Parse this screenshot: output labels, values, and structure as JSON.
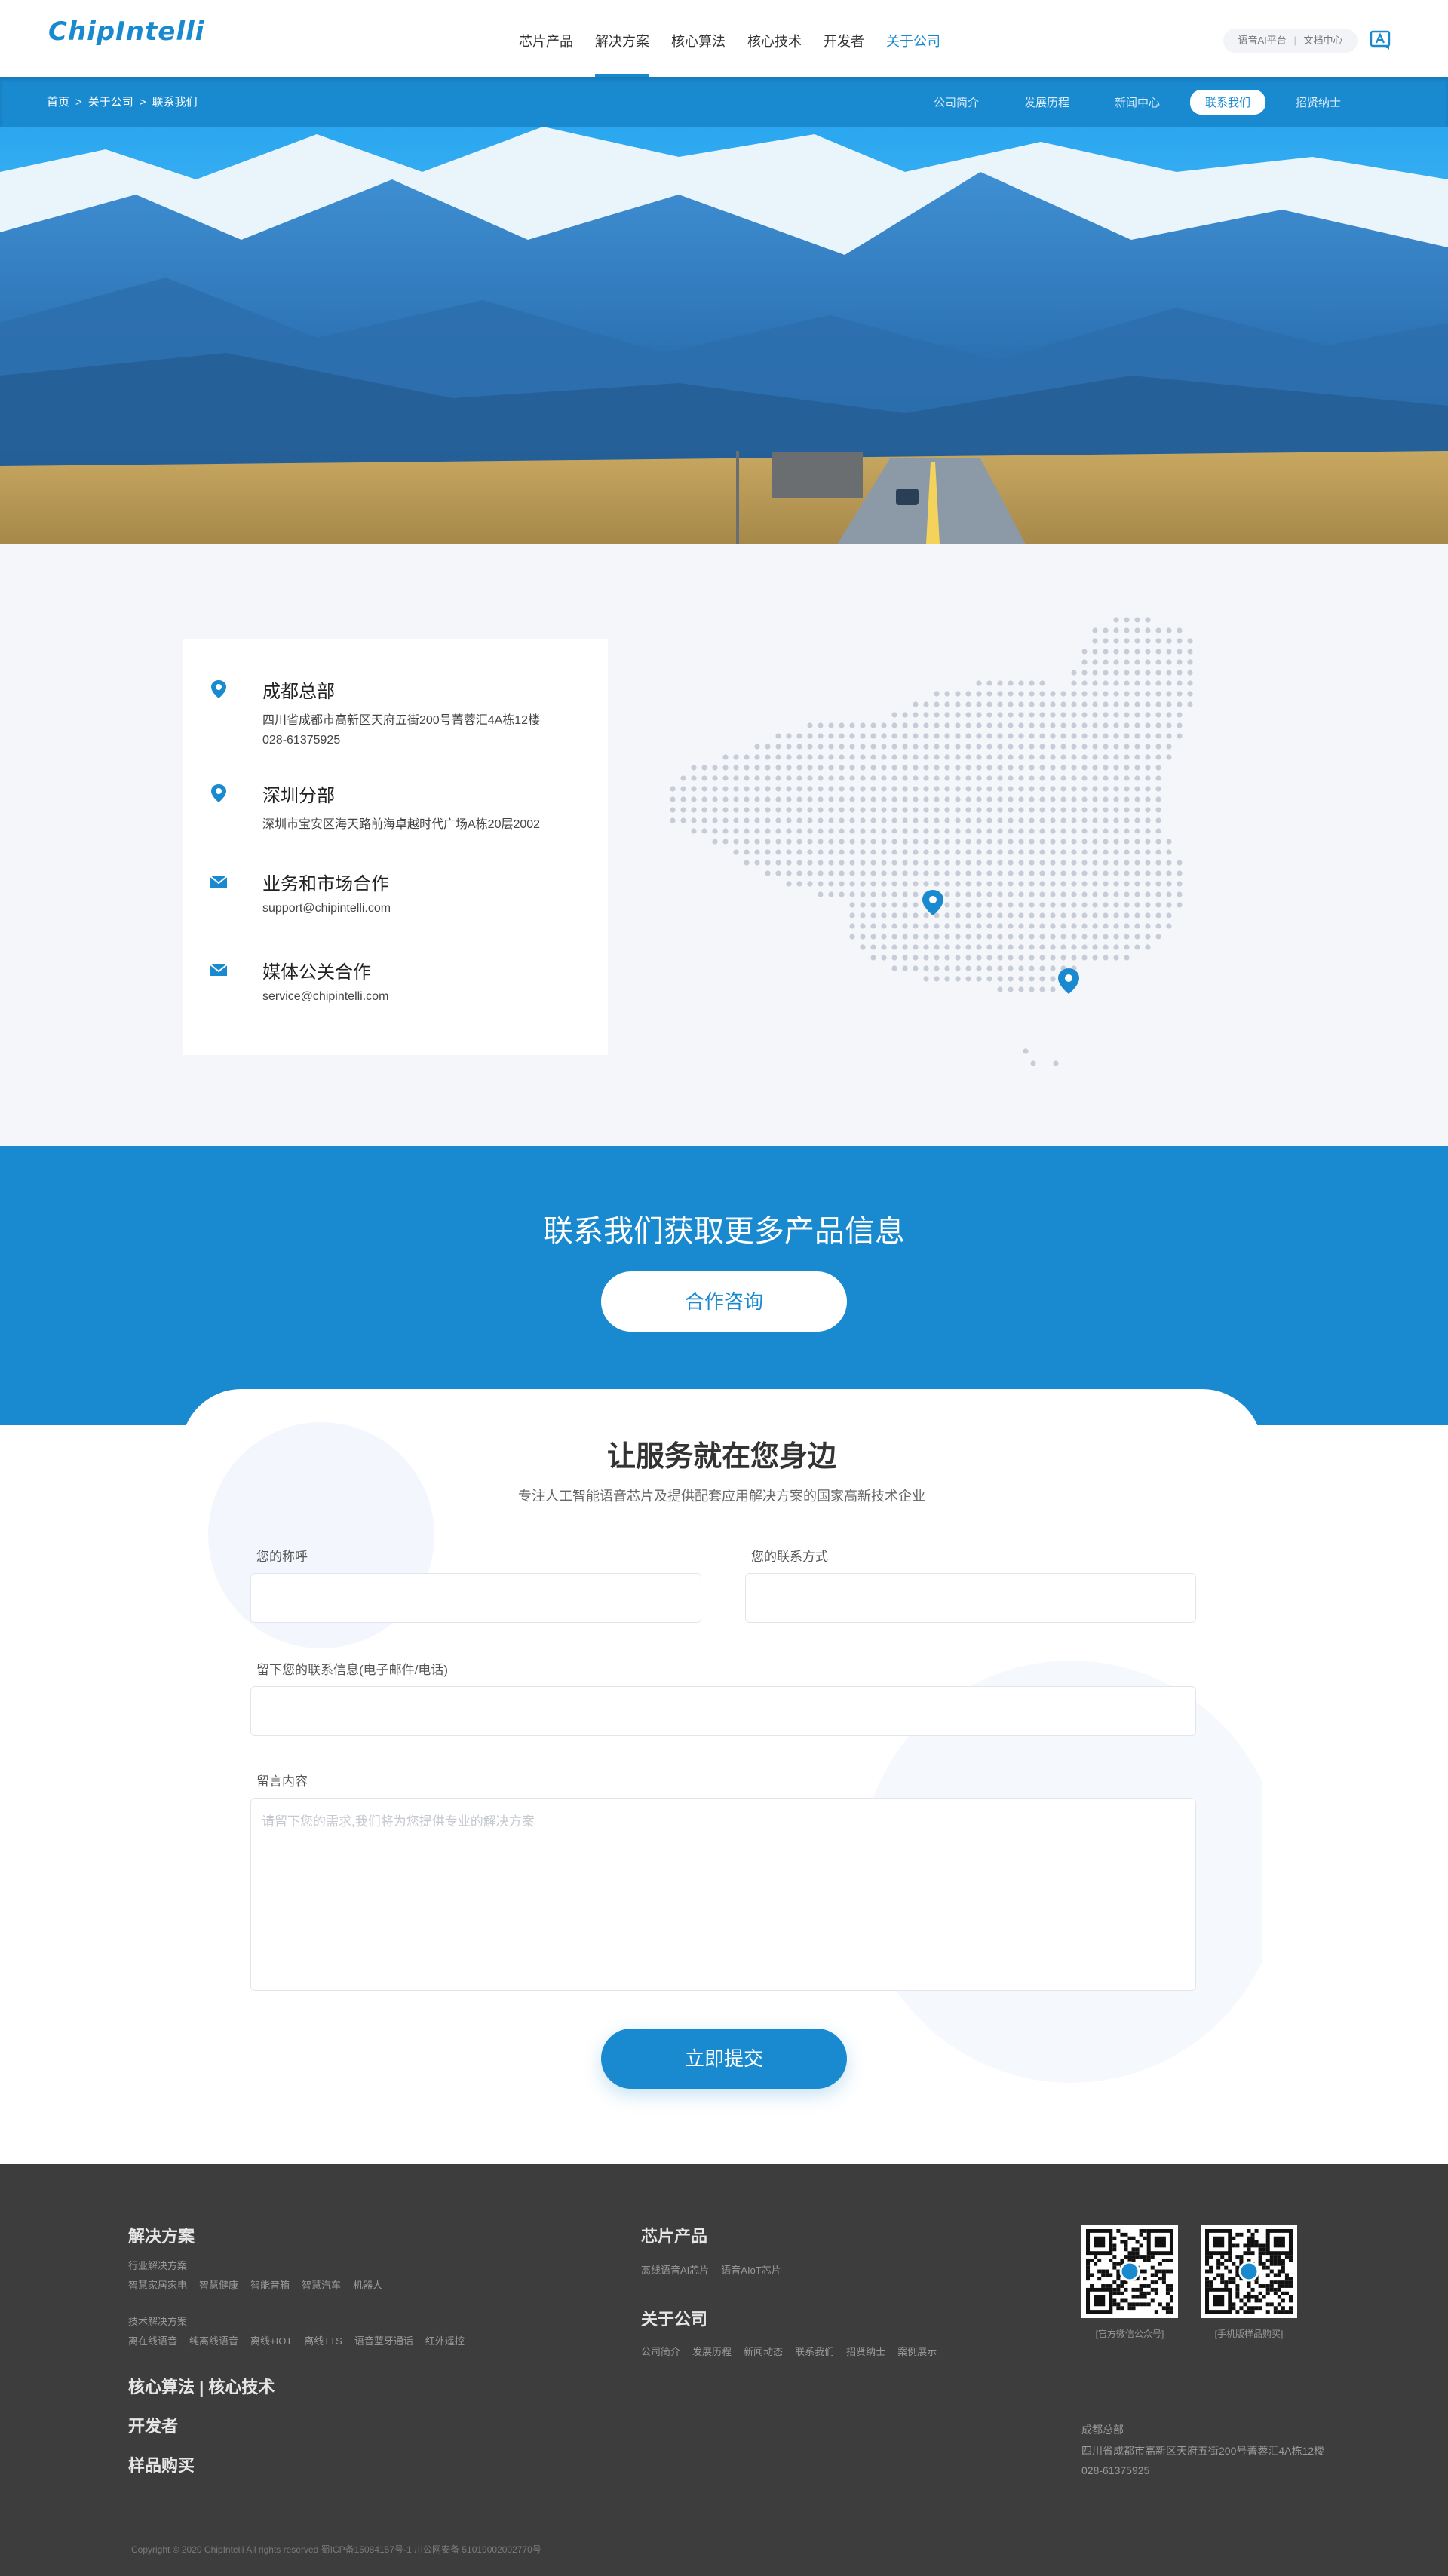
{
  "header": {
    "logo": "ChipIntelli",
    "nav": [
      "芯片产品",
      "解决方案",
      "核心算法",
      "核心技术",
      "开发者",
      "关于公司"
    ],
    "pill_left": "语音AI平台",
    "pill_sep": "|",
    "pill_right": "文档中心"
  },
  "subnav": {
    "breadcrumb": [
      "首页",
      "关于公司",
      "联系我们"
    ],
    "breadcrumb_sep": ">",
    "tabs": [
      "公司简介",
      "发展历程",
      "新闻中心",
      "联系我们",
      "招贤纳士"
    ]
  },
  "offices": {
    "hq_title": "成都总部",
    "hq_address": "四川省成都市高新区天府五街200号菁蓉汇4A栋12楼",
    "hq_phone": "028-61375925",
    "sz_title": "深圳分部",
    "sz_address": "深圳市宝安区海天路前海卓越时代广场A栋20层2002",
    "biz_title": "业务和市场合作",
    "biz_email": "support@chipintelli.com",
    "media_title": "媒体公关合作",
    "media_email": "service@chipintelli.com"
  },
  "cta": {
    "title": "联系我们获取更多产品信息",
    "button": "合作咨询"
  },
  "form": {
    "title": "让服务就在您身边",
    "subtitle": "专注人工智能语音芯片及提供配套应用解决方案的国家高新技术企业",
    "name_label": "您的称呼",
    "contact_label": "您的联系方式",
    "info_label": "留下您的联系信息(电子邮件/电话)",
    "message_label": "留言内容",
    "message_placeholder": "请留下您的需求,我们将为您提供专业的解决方案",
    "submit": "立即提交"
  },
  "footer": {
    "solutions_title": "解决方案",
    "industry_label": "行业解决方案",
    "industry_links": [
      "智慧家居家电",
      "智慧健康",
      "智能音箱",
      "智慧汽车",
      "机器人"
    ],
    "tech_label": "技术解决方案",
    "tech_links": [
      "离在线语音",
      "纯离线语音",
      "离线+IOT",
      "离线TTS",
      "语音蓝牙通话",
      "红外遥控"
    ],
    "algo_title": "核心算法 | 核心技术",
    "dev_title": "开发者",
    "buy_title": "样品购买",
    "chips_title": "芯片产品",
    "chip_links": [
      "离线语音AI芯片",
      "语音AIoT芯片"
    ],
    "about_title": "关于公司",
    "about_links": [
      "公司简介",
      "发展历程",
      "新闻动态",
      "联系我们",
      "招贤纳士",
      "案例展示"
    ],
    "qr1_caption": "[官方微信公众号]",
    "qr2_caption": "[手机版样品购买]",
    "address_title": "成都总部",
    "address": "四川省成都市高新区天府五街200号菁蓉汇4A栋12楼",
    "phone": "028-61375925",
    "copyright": "Copyright © 2020 ChipIntelli    All rights reserved    蜀ICP备15084157号-1  川公网安备 51019002002770号"
  },
  "colors": {
    "brand": "#1a8ad0",
    "footer_bg": "#3d3d3d",
    "section_bg": "#f4f6fa"
  }
}
